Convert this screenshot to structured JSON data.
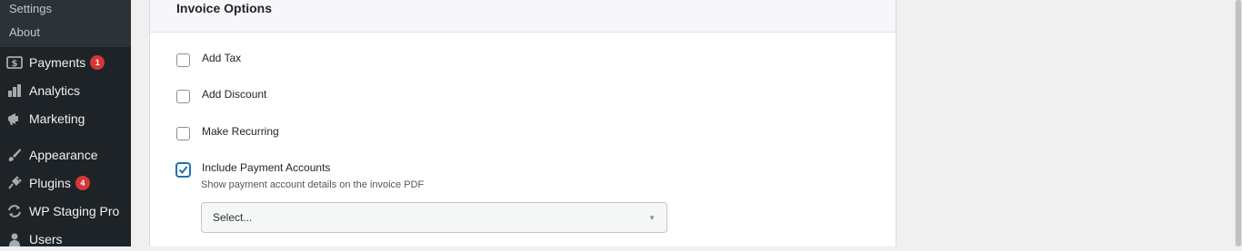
{
  "sidebar": {
    "submenu": [
      {
        "label": "Settings"
      },
      {
        "label": "About"
      }
    ],
    "items": [
      {
        "label": "Payments",
        "icon": "dollar-icon",
        "badge": "1"
      },
      {
        "label": "Analytics",
        "icon": "bar-chart-icon"
      },
      {
        "label": "Marketing",
        "icon": "megaphone-icon"
      },
      {
        "label": "Appearance",
        "icon": "paintbrush-icon"
      },
      {
        "label": "Plugins",
        "icon": "plug-icon",
        "badge": "4"
      },
      {
        "label": "WP Staging Pro",
        "icon": "refresh-icon"
      },
      {
        "label": "Users",
        "icon": "user-icon"
      }
    ]
  },
  "panel": {
    "title": "Invoice Options",
    "options": [
      {
        "label": "Add Tax",
        "checked": false
      },
      {
        "label": "Add Discount",
        "checked": false
      },
      {
        "label": "Make Recurring",
        "checked": false
      },
      {
        "label": "Include Payment Accounts",
        "checked": true
      }
    ],
    "payment_accounts_description": "Show payment account details on the invoice PDF",
    "payment_accounts_select": {
      "value": "Select..."
    }
  },
  "colors": {
    "sidebar_bg": "#1d2327",
    "accent": "#2271b1",
    "badge": "#d63638"
  }
}
